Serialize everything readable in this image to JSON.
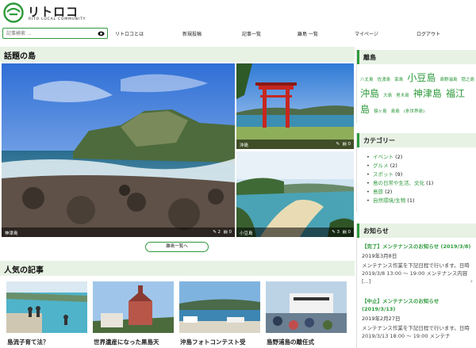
{
  "header": {
    "logo_name": "リトロコ",
    "logo_sub": "RITO LOCAL COMMUNITY",
    "search_placeholder": "記事検索 ..."
  },
  "nav": {
    "items": [
      "リトロコとは",
      "新規投稿",
      "記事一覧",
      "離島 一覧",
      "マイページ",
      "ログアウト"
    ]
  },
  "featured": {
    "title": "話題の島",
    "items": [
      {
        "name": "神津島",
        "likes": "2",
        "comments": "0"
      },
      {
        "name": "沖島",
        "likes": "",
        "comments": "0"
      },
      {
        "name": "小豆島",
        "likes": "3",
        "comments": "0"
      }
    ],
    "more_label": "離島一覧へ"
  },
  "popular": {
    "title": "人気の記事",
    "cards": [
      "島流子育て法？",
      "世界遺産になった黒島天",
      "沖島フォトコンテスト受",
      "島野浦島の離任式"
    ]
  },
  "islands_widget": {
    "title": "離島",
    "tags": [
      "八丈島",
      "佐渡島",
      "家島",
      "小豆島",
      "島野浦島",
      "隠之島",
      "沖島",
      "大島",
      "男木島",
      "神津島",
      "福江",
      "島",
      "猿ヶ島",
      "島島",
      "(条世界島)"
    ]
  },
  "category_widget": {
    "title": "カテゴリー",
    "items": [
      {
        "name": "イベント",
        "count": "(2)"
      },
      {
        "name": "グルメ",
        "count": "(2)"
      },
      {
        "name": "スポット",
        "count": "(9)"
      },
      {
        "name": "島の日常や生活、文化",
        "count": "(1)"
      },
      {
        "name": "島旅",
        "count": "(2)"
      },
      {
        "name": "自然環境/生物",
        "count": "(1)"
      }
    ]
  },
  "news_widget": {
    "title": "お知らせ",
    "items": [
      {
        "title": "【完了】メンテナンスのお知らせ (2019/3/8)",
        "date": "2019年3月8日",
        "body": "メンテナンス作業を下記日程で行います。日時 2019/3/8 13:00 ～ 19:00 メンテナンス内容 [...]"
      },
      {
        "title": "【中止】メンテナンスのお知らせ (2019/3/13)",
        "date": "2019年2月27日",
        "body": "メンテナンス作業を下記日程で行います。日時 2019/3/13 18:00 ～ 19:00 メンテナ"
      }
    ]
  }
}
